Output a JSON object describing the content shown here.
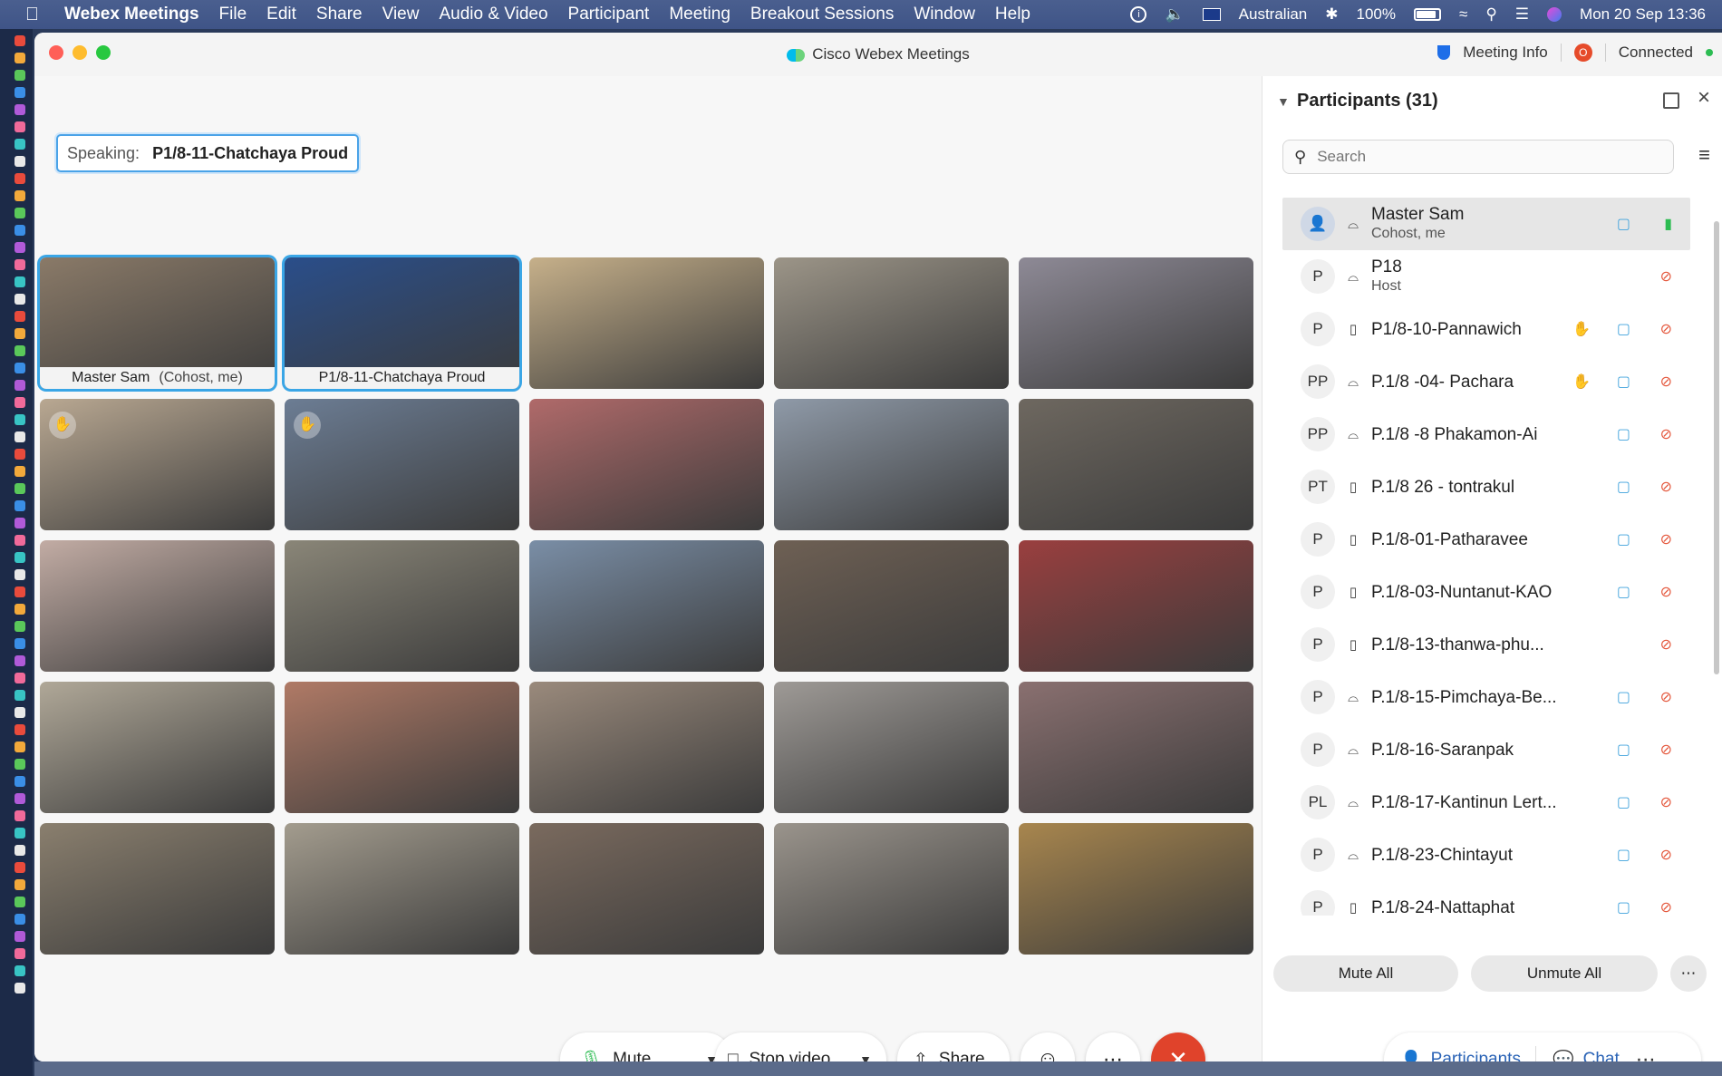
{
  "menubar": {
    "app_name": "Webex Meetings",
    "items": [
      "File",
      "Edit",
      "Share",
      "View",
      "Audio & Video",
      "Participant",
      "Meeting",
      "Breakout Sessions",
      "Window",
      "Help"
    ],
    "input_source": "Australian",
    "battery": "100%",
    "datetime": "Mon 20 Sep  13:36"
  },
  "window": {
    "title": "Cisco Webex Meetings",
    "meeting_info": "Meeting Info",
    "record_badge": "O",
    "status": "Connected"
  },
  "speaking": {
    "label": "Speaking:",
    "name": "P1/8-11-Chatchaya Proud"
  },
  "tiles": [
    {
      "name": "Master Sam",
      "sub": "(Cohost, me)",
      "color": "#8a7a68",
      "active": true,
      "hand": false
    },
    {
      "name": "P1/8-11-Chatchaya Proud",
      "sub": "",
      "color": "#2a4e8a",
      "active": true,
      "hand": false
    },
    {
      "name": "",
      "color": "#c6b08a",
      "hand": false
    },
    {
      "name": "",
      "color": "#9c9588",
      "hand": false
    },
    {
      "name": "",
      "color": "#8e8a96",
      "hand": false
    },
    {
      "name": "",
      "color": "#b9a892",
      "hand": true
    },
    {
      "name": "",
      "color": "#6c7d94",
      "hand": true
    },
    {
      "name": "",
      "color": "#b06a6a",
      "hand": false
    },
    {
      "name": "",
      "color": "#8f9aa8",
      "hand": false
    },
    {
      "name": "",
      "color": "#6e6860",
      "hand": false
    },
    {
      "name": "",
      "color": "#c2aca4",
      "hand": false
    },
    {
      "name": "",
      "color": "#8a8678",
      "hand": false
    },
    {
      "name": "",
      "color": "#7a8ea6",
      "hand": false
    },
    {
      "name": "",
      "color": "#6e6054",
      "hand": false
    },
    {
      "name": "",
      "color": "#9a3f3f",
      "hand": false
    },
    {
      "name": "",
      "color": "#b0a898",
      "hand": false
    },
    {
      "name": "",
      "color": "#b07a66",
      "hand": false
    },
    {
      "name": "",
      "color": "#9a8a7c",
      "hand": false
    },
    {
      "name": "",
      "color": "#9e9a96",
      "hand": false
    },
    {
      "name": "",
      "color": "#8a7070",
      "hand": false
    },
    {
      "name": "",
      "color": "#8a7f6e",
      "hand": false
    },
    {
      "name": "",
      "color": "#a39c8e",
      "hand": false
    },
    {
      "name": "",
      "color": "#7a6a5e",
      "hand": false
    },
    {
      "name": "",
      "color": "#9a948c",
      "hand": false
    },
    {
      "name": "",
      "color": "#a8864e",
      "hand": false
    }
  ],
  "controls": {
    "mute": "Mute",
    "stop_video": "Stop video",
    "share": "Share",
    "end": "✕"
  },
  "panel": {
    "title": "Participants (31)",
    "search_placeholder": "Search",
    "participants": [
      {
        "initials": "",
        "name": "Master Sam",
        "role": "Cohost, me",
        "device": "headset",
        "hand": false,
        "camera": true,
        "mic": "on",
        "selected": true
      },
      {
        "initials": "P",
        "name": "P18",
        "role": "Host",
        "device": "headset",
        "hand": false,
        "camera": false,
        "mic": "muted"
      },
      {
        "initials": "P",
        "name": "P1/8-10-Pannawich",
        "role": "",
        "device": "phone",
        "hand": true,
        "camera": true,
        "mic": "muted"
      },
      {
        "initials": "PP",
        "name": "P.1/8 -04- Pachara",
        "role": "",
        "device": "headset",
        "hand": true,
        "camera": true,
        "mic": "muted"
      },
      {
        "initials": "PP",
        "name": "P.1/8 -8 Phakamon-Ai",
        "role": "",
        "device": "headset",
        "hand": false,
        "camera": true,
        "mic": "muted"
      },
      {
        "initials": "PT",
        "name": "P.1/8 26 - tontrakul",
        "role": "",
        "device": "phone",
        "hand": false,
        "camera": true,
        "mic": "muted"
      },
      {
        "initials": "P",
        "name": "P.1/8-01-Patharavee",
        "role": "",
        "device": "phone",
        "hand": false,
        "camera": true,
        "mic": "muted"
      },
      {
        "initials": "P",
        "name": "P.1/8-03-Nuntanut-KAO",
        "role": "",
        "device": "phone",
        "hand": false,
        "camera": true,
        "mic": "muted"
      },
      {
        "initials": "P",
        "name": "P.1/8-13-thanwa-phu...",
        "role": "",
        "device": "phone",
        "hand": false,
        "camera": false,
        "mic": "muted"
      },
      {
        "initials": "P",
        "name": "P.1/8-15-Pimchaya-Be...",
        "role": "",
        "device": "headset",
        "hand": false,
        "camera": true,
        "mic": "muted"
      },
      {
        "initials": "P",
        "name": "P.1/8-16-Saranpak",
        "role": "",
        "device": "headset",
        "hand": false,
        "camera": true,
        "mic": "muted"
      },
      {
        "initials": "PL",
        "name": "P.1/8-17-Kantinun Lert...",
        "role": "",
        "device": "headset",
        "hand": false,
        "camera": true,
        "mic": "muted"
      },
      {
        "initials": "P",
        "name": "P.1/8-23-Chintayut",
        "role": "",
        "device": "headset",
        "hand": false,
        "camera": true,
        "mic": "muted"
      },
      {
        "initials": "P",
        "name": "P.1/8-24-Nattaphat",
        "role": "",
        "device": "phone",
        "hand": false,
        "camera": true,
        "mic": "muted"
      }
    ],
    "mute_all": "Mute All",
    "unmute_all": "Unmute All",
    "tab_participants": "Participants",
    "tab_chat": "Chat"
  },
  "icons": {
    "mic": "microphone-icon",
    "camera": "video-camera-icon",
    "share": "share-icon",
    "reactions": "smiley-icon",
    "more": "more-dots-icon",
    "end": "end-call-icon",
    "hand": "raise-hand-icon",
    "headset": "headset-icon",
    "phone": "phone-icon"
  },
  "colors": {
    "accent": "#41a3dc",
    "end_call": "#e0432b",
    "muted_mic": "#e4573c",
    "unmuted_mic": "#2cbc52",
    "tab_text": "#2a63b6"
  }
}
